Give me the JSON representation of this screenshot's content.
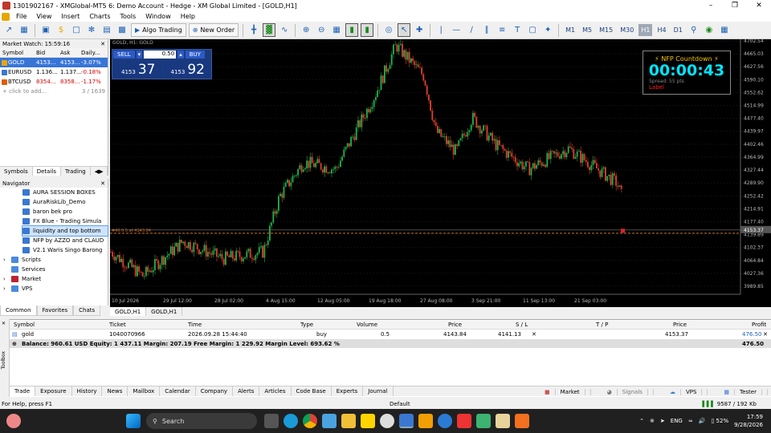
{
  "window": {
    "title": "1301902167 - XMGlobal-MT5 6: Demo Account - Hedge - XM Global Limited - [GOLD,H1]"
  },
  "menu": [
    "File",
    "View",
    "Insert",
    "Charts",
    "Tools",
    "Window",
    "Help"
  ],
  "toolbar": {
    "algo_label": "Algo Trading",
    "new_order_label": "New Order",
    "timeframes": [
      "M1",
      "M5",
      "M15",
      "M30",
      "H1",
      "H4",
      "D1"
    ],
    "selected_tf": "H1"
  },
  "market_watch": {
    "title": "Market Watch: 15:59:16",
    "columns": [
      "Symbol",
      "Bid",
      "Ask",
      "Daily..."
    ],
    "rows": [
      {
        "symbol": "GOLD",
        "bid": "4153...",
        "ask": "4153...",
        "daily": "-3.07%",
        "color": "#e6a700"
      },
      {
        "symbol": "EURUSD",
        "bid": "1.136...",
        "ask": "1.137...",
        "daily": "-0.18%",
        "color": "#3b77d0"
      },
      {
        "symbol": "BTCUSD",
        "bid": "8354...",
        "ask": "8358...",
        "daily": "-1.17%",
        "color": "#e35b00"
      }
    ],
    "add_label": "click to add...",
    "count": "3 / 1639",
    "tabs": [
      "Symbols",
      "Details",
      "Trading"
    ]
  },
  "navigator": {
    "title": "Navigator",
    "items": [
      "AURA SESSION BOXES",
      "AuraRiskLib_Demo",
      "baron bek pro",
      "FX Blue - Trading Simula",
      "liquidity and top bottom",
      "NFP by AZZO and CLAUD",
      "V2.1 Waris Singo Barong"
    ],
    "highlighted": "liquidity and top bottom",
    "folders": [
      "Scripts",
      "Services",
      "Market",
      "VPS"
    ],
    "tabs": [
      "Common",
      "Favorites",
      "Chats"
    ]
  },
  "chart": {
    "header": "GOLD, H1:  GOLD",
    "trade_panel": {
      "sell": "SELL",
      "buy": "BUY",
      "volume": "0.50",
      "sell_small": "4153",
      "sell_big": "37",
      "buy_small": "4153",
      "buy_big": "92"
    },
    "nfp": {
      "title": "NFP Countdown",
      "countdown": "00:00:43",
      "spread": "Spread: 55 pts",
      "label": "Label"
    },
    "price_ticks": [
      "4702.54",
      "4665.03",
      "4627.56",
      "4590.10",
      "4552.62",
      "4514.99",
      "4477.40",
      "4439.97",
      "4402.46",
      "4364.99",
      "4327.44",
      "4289.90",
      "4252.42",
      "4214.91",
      "4177.40",
      "4139.89",
      "4102.37",
      "4064.84",
      "4027.36",
      "3989.85"
    ],
    "current_price": "4153.37",
    "order_line_label": "#40 0.5 at 4143.84",
    "time_ticks": [
      "10 Jul 2026",
      "29 Jul 12:00",
      "28 Jul 02:00",
      "4 Aug 15:00",
      "12 Aug 05:00",
      "19 Aug 18:00",
      "27 Aug 08:00",
      "3 Sep 21:00",
      "11 Sep 13:00",
      "21 Sep 03:00"
    ],
    "tabs": [
      "GOLD,H1",
      "GOLD,H1"
    ],
    "bull_color": "#22b14c",
    "bear_color": "#e0402a",
    "bg": "#000000"
  },
  "toolbox": {
    "columns": [
      "Symbol",
      "Ticket",
      "Time",
      "Type",
      "Volume",
      "Price",
      "S / L",
      "T / P",
      "Price",
      "Profit"
    ],
    "row": {
      "symbol": "gold",
      "ticket": "1040070966",
      "time": "2026.09.28 15:44:40",
      "type": "buy",
      "volume": "0.5",
      "price": "4143.84",
      "sl": "4141.13",
      "tp": "",
      "cur_price": "4153.37",
      "profit": "476.50"
    },
    "balance": "Balance: 960.61 USD  Equity: 1 437.11  Margin: 207.19  Free Margin: 1 229.92  Margin Level: 693.62 %",
    "balance_profit": "476.50",
    "side_label": "Toolbox",
    "tabs": [
      "Trade",
      "Exposure",
      "History",
      "News",
      "Mailbox",
      "Calendar",
      "Company",
      "Alerts",
      "Articles",
      "Code Base",
      "Experts",
      "Journal"
    ],
    "right_tabs": [
      "Market",
      "Signals",
      "VPS",
      "Tester"
    ]
  },
  "status": {
    "help": "For Help, press F1",
    "profile": "Default",
    "traffic": "9587 / 192 Kb"
  },
  "taskbar": {
    "search": "Search",
    "lang": "ENG",
    "battery": "52%",
    "time": "17:59",
    "date": "9/28/2026"
  }
}
